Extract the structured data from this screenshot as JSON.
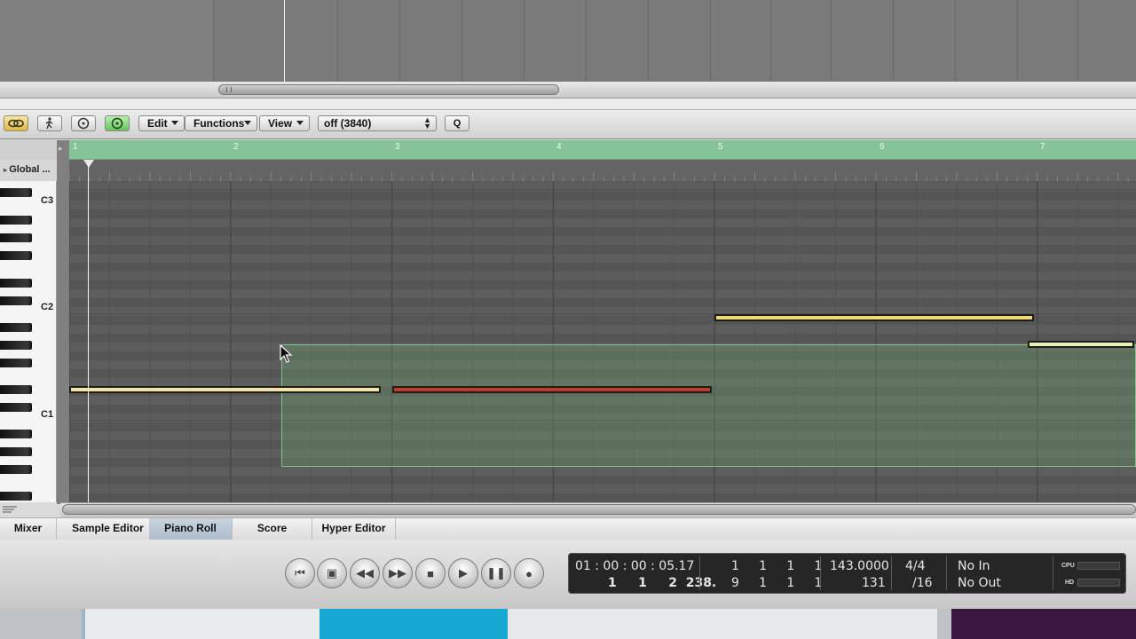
{
  "toolbar": {
    "edit_label": "Edit",
    "functions_label": "Functions",
    "view_label": "View",
    "quantize_value": "off (3840)",
    "q_label": "Q"
  },
  "global_track_label": "Global ...",
  "keyboard_labels": [
    "C3",
    "C2",
    "C1"
  ],
  "ruler_bars": [
    "1",
    "2",
    "3",
    "4",
    "5",
    "6",
    "7"
  ],
  "tabs": [
    "Mixer",
    "Sample Editor",
    "Piano Roll",
    "Score",
    "Hyper Editor"
  ],
  "active_tab": "Piano Roll",
  "transport": {
    "smpte": "01 : 00 : 00 : 05.17",
    "bbt": "1     1     2  238.",
    "locator_left": "1     1     1     1",
    "locator_right": "9     1     1     1",
    "tempo": "143.0000",
    "division": "131",
    "signature": "4/4",
    "sig_div": "/16",
    "midi_in": "No In",
    "midi_out": "No Out",
    "cpu_label": "CPU",
    "hd_label": "HD"
  },
  "notes": [
    {
      "start_bar": 1.0,
      "end_bar": 2.93,
      "pitch_row": "C1+1",
      "color": "#f3e2a2"
    },
    {
      "start_bar": 3.0,
      "end_bar": 4.98,
      "pitch_row": "C1+1",
      "color": "#c23a20"
    },
    {
      "start_bar": 5.0,
      "end_bar": 6.98,
      "pitch_row": "C2-1",
      "color": "#f6d870"
    },
    {
      "start_bar": 6.94,
      "end_bar": 7.6,
      "pitch_row": "C2-2",
      "color": "#e6efb2"
    }
  ]
}
